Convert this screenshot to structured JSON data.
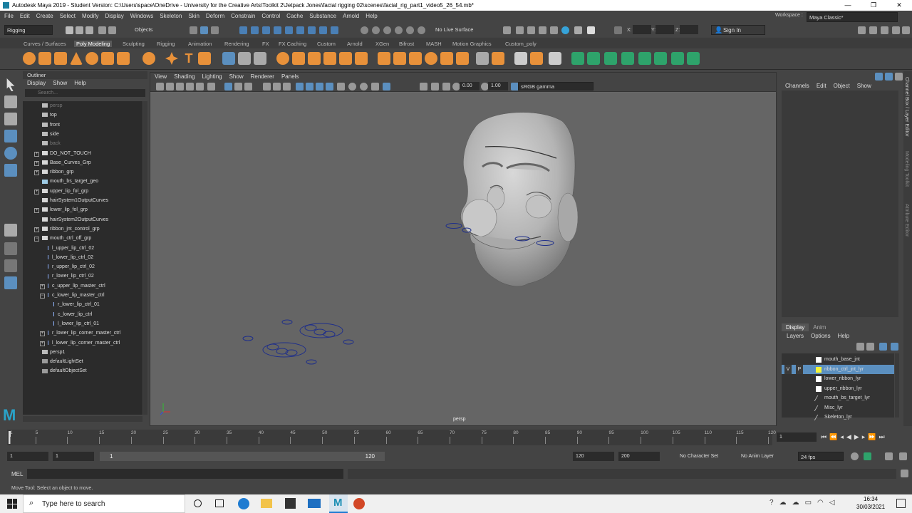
{
  "window": {
    "title": "Autodesk Maya 2019 - Student Version: C:\\Users\\space\\OneDrive - University for the Creative Arts\\Toolkit 2\\Jetpack Jones\\facial rigging 02\\scenes\\facial_rig_part1_video5_26_54.mb*",
    "controls": [
      "—",
      "❐",
      "✕"
    ]
  },
  "menubar": [
    "File",
    "Edit",
    "Create",
    "Select",
    "Modify",
    "Display",
    "Windows",
    "Skeleton",
    "Skin",
    "Deform",
    "Constrain",
    "Control",
    "Cache",
    "Substance",
    "Arnold",
    "Help"
  ],
  "statusline": {
    "menuset": "Rigging",
    "selection_mode": "Objects",
    "live_surface": "No Live Surface",
    "xyz_labels": [
      "X:",
      "Y:",
      "Z:"
    ],
    "sign_in": "Sign In",
    "workspace_label": "Workspace :",
    "workspace": "Maya Classic*"
  },
  "shelf_tabs": [
    "Curves / Surfaces",
    "Poly Modeling",
    "Sculpting",
    "Rigging",
    "Animation",
    "Rendering",
    "FX",
    "FX Caching",
    "Custom",
    "Arnold",
    "XGen",
    "Bifrost",
    "MASH",
    "Motion Graphics",
    "Custom_poly"
  ],
  "shelf_active": "Poly Modeling",
  "outliner": {
    "title": "Outliner",
    "menu": [
      "Display",
      "Show",
      "Help"
    ],
    "search_placeholder": "Search...",
    "items": [
      {
        "label": "persp",
        "level": 0,
        "expand": "",
        "dim": true,
        "kind": "camera"
      },
      {
        "label": "top",
        "level": 0,
        "expand": "",
        "dim": false,
        "kind": "camera"
      },
      {
        "label": "front",
        "level": 0,
        "expand": "",
        "dim": false,
        "kind": "camera"
      },
      {
        "label": "side",
        "level": 0,
        "expand": "",
        "dim": false,
        "kind": "camera"
      },
      {
        "label": "back",
        "level": 0,
        "expand": "",
        "dim": true,
        "kind": "camera"
      },
      {
        "label": "DO_NOT_TOUCH",
        "level": 0,
        "expand": "+",
        "dim": false,
        "kind": "group"
      },
      {
        "label": "Base_Curves_Grp",
        "level": 0,
        "expand": "+",
        "dim": false,
        "kind": "group"
      },
      {
        "label": "ribbon_grp",
        "level": 0,
        "expand": "+",
        "dim": false,
        "kind": "group"
      },
      {
        "label": "mouth_bs_target_geo",
        "level": 0,
        "expand": "",
        "dim": false,
        "kind": "mesh"
      },
      {
        "label": "upper_lip_fol_grp",
        "level": 0,
        "expand": "+",
        "dim": false,
        "kind": "group"
      },
      {
        "label": "hairSystem1OutputCurves",
        "level": 0,
        "expand": "",
        "dim": false,
        "kind": "group"
      },
      {
        "label": "lower_lip_fol_grp",
        "level": 0,
        "expand": "+",
        "dim": false,
        "kind": "group"
      },
      {
        "label": "hairSystem2OutputCurves",
        "level": 0,
        "expand": "",
        "dim": false,
        "kind": "group"
      },
      {
        "label": "ribbon_jnt_control_grp",
        "level": 0,
        "expand": "+",
        "dim": false,
        "kind": "group"
      },
      {
        "label": "mouth_ctrl_off_grp",
        "level": 0,
        "expand": "−",
        "dim": false,
        "kind": "group"
      },
      {
        "label": "l_upper_lip_ctrl_02",
        "level": 1,
        "expand": "",
        "dim": false,
        "kind": "curve"
      },
      {
        "label": "l_lower_lip_ctrl_02",
        "level": 1,
        "expand": "",
        "dim": false,
        "kind": "curve"
      },
      {
        "label": "r_upper_lip_ctrl_02",
        "level": 1,
        "expand": "",
        "dim": false,
        "kind": "curve"
      },
      {
        "label": "r_lower_lip_ctrl_02",
        "level": 1,
        "expand": "",
        "dim": false,
        "kind": "curve"
      },
      {
        "label": "c_upper_lip_master_ctrl",
        "level": 1,
        "expand": "+",
        "dim": false,
        "kind": "curve"
      },
      {
        "label": "c_lower_lip_master_ctrl",
        "level": 1,
        "expand": "−",
        "dim": false,
        "kind": "curve"
      },
      {
        "label": "r_lower_lip_ctrl_01",
        "level": 2,
        "expand": "",
        "dim": false,
        "kind": "curve"
      },
      {
        "label": "c_lower_lip_ctrl",
        "level": 2,
        "expand": "",
        "dim": false,
        "kind": "curve"
      },
      {
        "label": "l_lower_lip_ctrl_01",
        "level": 2,
        "expand": "",
        "dim": false,
        "kind": "curve"
      },
      {
        "label": "r_lower_lip_corner_master_ctrl",
        "level": 1,
        "expand": "+",
        "dim": false,
        "kind": "curve"
      },
      {
        "label": "l_lower_lip_corner_master_ctrl",
        "level": 1,
        "expand": "+",
        "dim": false,
        "kind": "curve"
      },
      {
        "label": "persp1",
        "level": 0,
        "expand": "",
        "dim": false,
        "kind": "camera"
      },
      {
        "label": "defaultLightSet",
        "level": 0,
        "expand": "",
        "dim": false,
        "kind": "set"
      },
      {
        "label": "defaultObjectSet",
        "level": 0,
        "expand": "",
        "dim": false,
        "kind": "set"
      }
    ]
  },
  "viewport": {
    "menu": [
      "View",
      "Shading",
      "Lighting",
      "Show",
      "Renderer",
      "Panels"
    ],
    "exposure": "0.00",
    "gamma": "1.00",
    "colorspace": "sRGB gamma",
    "camera_label": "persp"
  },
  "channelbox": {
    "menu": [
      "Channels",
      "Edit",
      "Object",
      "Show"
    ],
    "side_tabs": [
      "Channel Box / Layer Editor",
      "Modeling Toolkit",
      "Attribute Editor"
    ]
  },
  "layer_editor": {
    "tabs": [
      "Display",
      "Anim"
    ],
    "menu": [
      "Layers",
      "Options",
      "Help"
    ],
    "layers": [
      {
        "name": "mouth_base_jnt",
        "color": "#ffffff",
        "v": "",
        "p": "",
        "selected": false
      },
      {
        "name": "ribbon_ctrl_jnt_lyr",
        "color": "#f5f53a",
        "v": "V",
        "p": "P",
        "selected": true
      },
      {
        "name": "lower_ribbon_lyr",
        "color": "#ffffff",
        "v": "",
        "p": "",
        "selected": false
      },
      {
        "name": "upper_ribbon_lyr",
        "color": "#ffffff",
        "v": "",
        "p": "",
        "selected": false
      },
      {
        "name": "mouth_bs_target_lyr",
        "color": "",
        "v": "",
        "p": "",
        "selected": false
      },
      {
        "name": "Misc_lyr",
        "color": "",
        "v": "",
        "p": "",
        "selected": false
      },
      {
        "name": "Skeleton_lyr",
        "color": "",
        "v": "",
        "p": "",
        "selected": false
      }
    ]
  },
  "timeline": {
    "ticks": [
      "1",
      "5",
      "10",
      "15",
      "20",
      "25",
      "30",
      "35",
      "40",
      "45",
      "50",
      "55",
      "60",
      "65",
      "70",
      "75",
      "80",
      "85",
      "90",
      "95",
      "100",
      "105",
      "110",
      "115",
      "120"
    ],
    "current_frame": "1",
    "range_start": "1",
    "anim_start": "1",
    "slider_start": "1",
    "slider_end": "120",
    "range_end": "120",
    "anim_end": "200",
    "character_set": "No Character Set",
    "anim_layer": "No Anim Layer",
    "fps": "24 fps"
  },
  "cmdline": {
    "label": "MEL"
  },
  "helpline": {
    "text": "Move Tool: Select an object to move."
  },
  "taskbar": {
    "search_placeholder": "Type here to search",
    "time": "16:34",
    "date": "30/03/2021"
  }
}
